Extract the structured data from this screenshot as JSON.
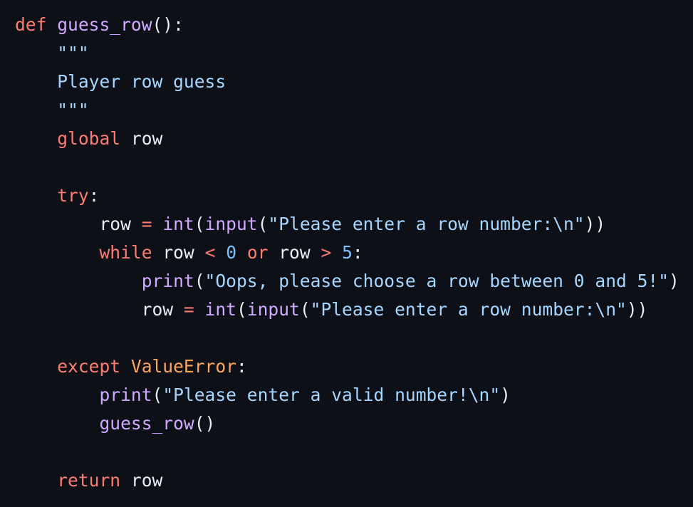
{
  "code": {
    "lines": [
      [
        {
          "text": "def",
          "type": "keyword"
        },
        {
          "text": " ",
          "type": "plain"
        },
        {
          "text": "guess_row",
          "type": "func"
        },
        {
          "text": "():",
          "type": "plain"
        }
      ],
      [
        {
          "text": "    ",
          "type": "plain"
        },
        {
          "text": "\"\"\"",
          "type": "string"
        }
      ],
      [
        {
          "text": "    Player row guess",
          "type": "string"
        }
      ],
      [
        {
          "text": "    ",
          "type": "plain"
        },
        {
          "text": "\"\"\"",
          "type": "string"
        }
      ],
      [
        {
          "text": "    ",
          "type": "plain"
        },
        {
          "text": "global",
          "type": "keyword"
        },
        {
          "text": " row",
          "type": "plain"
        }
      ],
      [],
      [
        {
          "text": "    ",
          "type": "plain"
        },
        {
          "text": "try",
          "type": "keyword"
        },
        {
          "text": ":",
          "type": "plain"
        }
      ],
      [
        {
          "text": "        row ",
          "type": "plain"
        },
        {
          "text": "=",
          "type": "operator"
        },
        {
          "text": " ",
          "type": "plain"
        },
        {
          "text": "int",
          "type": "builtin"
        },
        {
          "text": "(",
          "type": "plain"
        },
        {
          "text": "input",
          "type": "builtin"
        },
        {
          "text": "(",
          "type": "plain"
        },
        {
          "text": "\"Please enter a row number:\\n\"",
          "type": "string"
        },
        {
          "text": "))",
          "type": "plain"
        }
      ],
      [
        {
          "text": "        ",
          "type": "plain"
        },
        {
          "text": "while",
          "type": "keyword"
        },
        {
          "text": " row ",
          "type": "plain"
        },
        {
          "text": "<",
          "type": "operator"
        },
        {
          "text": " ",
          "type": "plain"
        },
        {
          "text": "0",
          "type": "number"
        },
        {
          "text": " ",
          "type": "plain"
        },
        {
          "text": "or",
          "type": "keyword"
        },
        {
          "text": " row ",
          "type": "plain"
        },
        {
          "text": ">",
          "type": "operator"
        },
        {
          "text": " ",
          "type": "plain"
        },
        {
          "text": "5",
          "type": "number"
        },
        {
          "text": ":",
          "type": "plain"
        }
      ],
      [
        {
          "text": "            ",
          "type": "plain"
        },
        {
          "text": "print",
          "type": "builtin"
        },
        {
          "text": "(",
          "type": "plain"
        },
        {
          "text": "\"Oops, please choose a row between 0 and 5!\"",
          "type": "string"
        },
        {
          "text": ")",
          "type": "plain"
        }
      ],
      [
        {
          "text": "            row ",
          "type": "plain"
        },
        {
          "text": "=",
          "type": "operator"
        },
        {
          "text": " ",
          "type": "plain"
        },
        {
          "text": "int",
          "type": "builtin"
        },
        {
          "text": "(",
          "type": "plain"
        },
        {
          "text": "input",
          "type": "builtin"
        },
        {
          "text": "(",
          "type": "plain"
        },
        {
          "text": "\"Please enter a row number:\\n\"",
          "type": "string"
        },
        {
          "text": "))",
          "type": "plain"
        }
      ],
      [],
      [
        {
          "text": "    ",
          "type": "plain"
        },
        {
          "text": "except",
          "type": "keyword"
        },
        {
          "text": " ",
          "type": "plain"
        },
        {
          "text": "ValueError",
          "type": "class"
        },
        {
          "text": ":",
          "type": "plain"
        }
      ],
      [
        {
          "text": "        ",
          "type": "plain"
        },
        {
          "text": "print",
          "type": "builtin"
        },
        {
          "text": "(",
          "type": "plain"
        },
        {
          "text": "\"Please enter a valid number!\\n\"",
          "type": "string"
        },
        {
          "text": ")",
          "type": "plain"
        }
      ],
      [
        {
          "text": "        ",
          "type": "plain"
        },
        {
          "text": "guess_row",
          "type": "func"
        },
        {
          "text": "()",
          "type": "plain"
        }
      ],
      [],
      [
        {
          "text": "    ",
          "type": "plain"
        },
        {
          "text": "return",
          "type": "keyword"
        },
        {
          "text": " row",
          "type": "plain"
        }
      ]
    ]
  }
}
